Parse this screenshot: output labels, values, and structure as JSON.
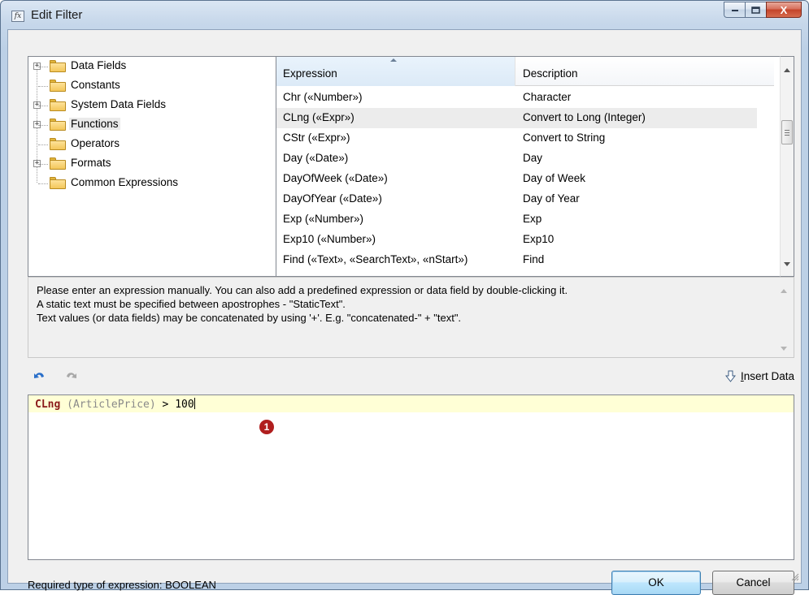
{
  "window": {
    "title": "Edit Filter",
    "icon_label": "fx",
    "close_glyph": "X",
    "max_glyph": "▫",
    "min_glyph": "_"
  },
  "tree": {
    "items": [
      {
        "label": "Data Fields",
        "expandable": true
      },
      {
        "label": "Constants",
        "expandable": false
      },
      {
        "label": "System Data Fields",
        "expandable": true
      },
      {
        "label": "Functions",
        "expandable": true,
        "selected": true
      },
      {
        "label": "Operators",
        "expandable": false
      },
      {
        "label": "Formats",
        "expandable": true
      },
      {
        "label": "Common Expressions",
        "expandable": false
      }
    ],
    "expander_glyph": "+"
  },
  "grid": {
    "columns": [
      "Expression",
      "Description"
    ],
    "rows": [
      {
        "expression": "Chr («Number»)",
        "description": "Character"
      },
      {
        "expression": "CLng («Expr»)",
        "description": "Convert to Long (Integer)",
        "selected": true
      },
      {
        "expression": "CStr («Expr»)",
        "description": "Convert to String"
      },
      {
        "expression": "Day («Date»)",
        "description": "Day"
      },
      {
        "expression": "DayOfWeek («Date»)",
        "description": "Day of Week"
      },
      {
        "expression": "DayOfYear («Date»)",
        "description": "Day of Year"
      },
      {
        "expression": "Exp («Number»)",
        "description": "Exp"
      },
      {
        "expression": "Exp10 («Number»)",
        "description": "Exp10"
      },
      {
        "expression": "Find («Text», «SearchText», «nStart»)",
        "description": "Find"
      }
    ]
  },
  "hint": {
    "lines": [
      "Please enter an expression manually. You can also add a predefined expression or data field by double-clicking it.",
      "A static text must be specified between apostrophes - \"StaticText\".",
      "Text values (or data fields) may be concatenated by using '+'. E.g. \"concatenated-\" + \"text\"."
    ]
  },
  "toolbar": {
    "insert_data_label_first": "I",
    "insert_data_label_rest": "nsert Data"
  },
  "editor": {
    "function_token": "CLng",
    "field_token": " (ArticlePrice)",
    "rest_token": " > 100",
    "marker": "1"
  },
  "footer": {
    "required_type": "Required type of expression: BOOLEAN",
    "ok_label": "OK",
    "cancel_label": "Cancel"
  },
  "colors": {
    "function_token": "#8b1a1a",
    "field_token": "#8a8a8a",
    "current_line": "#ffffd6",
    "marker": "#b01e1e"
  }
}
